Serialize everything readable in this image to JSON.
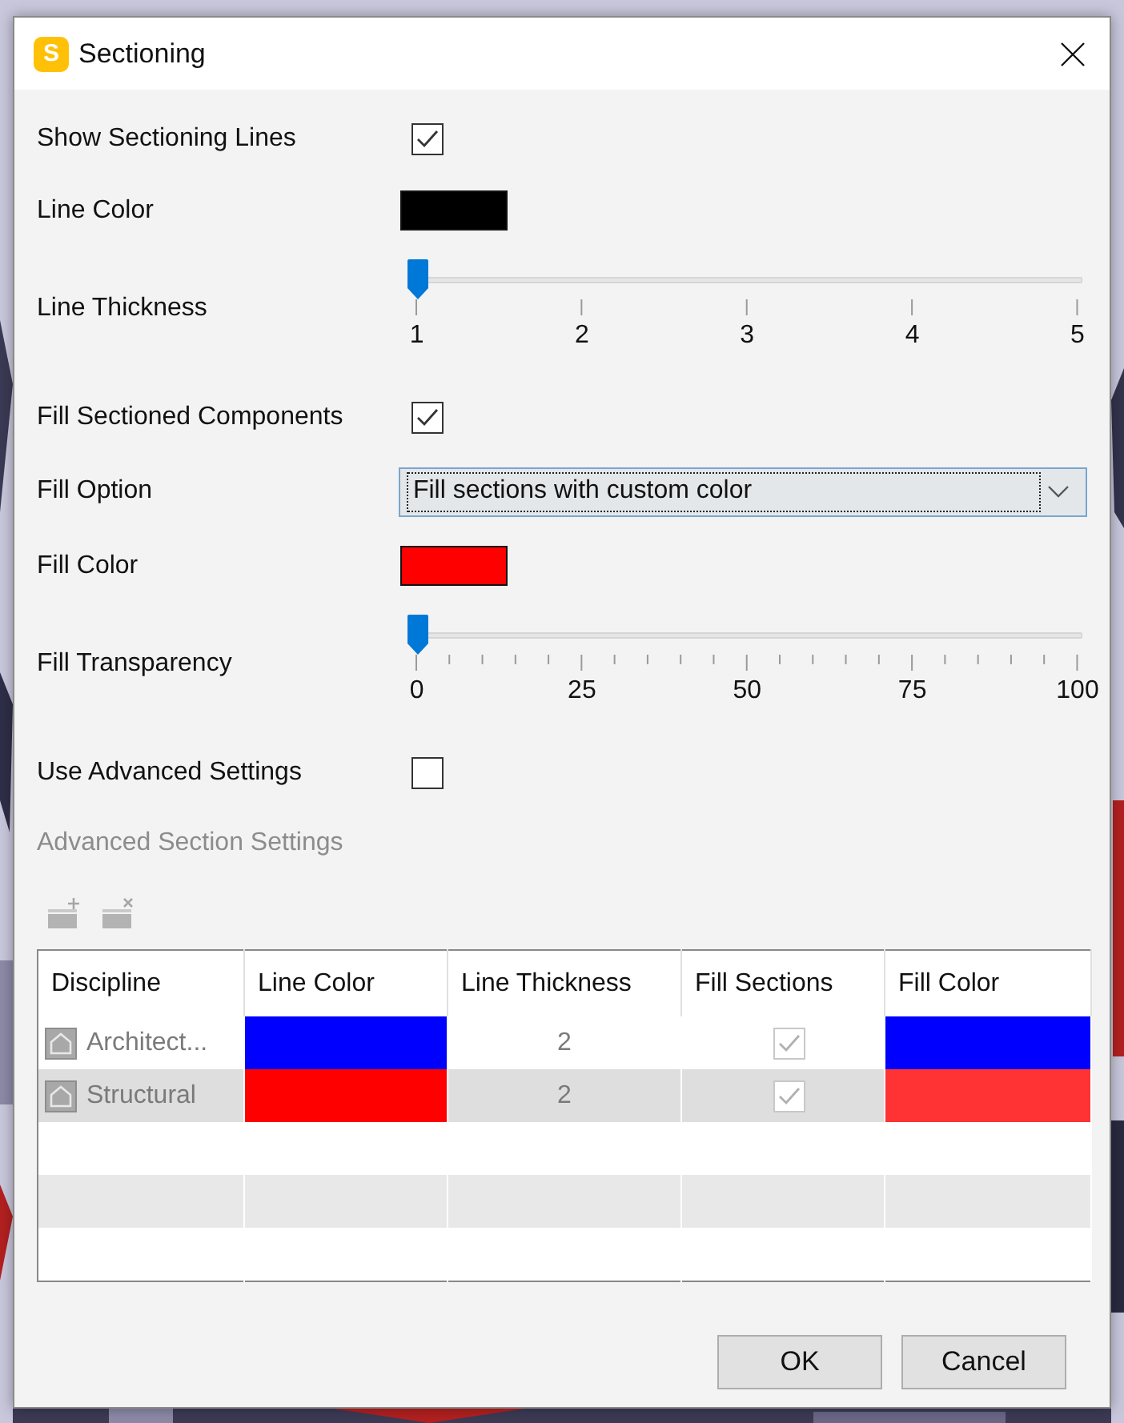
{
  "window": {
    "title": "Sectioning",
    "app_icon_letter": "S"
  },
  "settings": [
    {
      "kind": "checkbox",
      "label": "Show Sectioning Lines",
      "checked": true
    },
    {
      "kind": "color",
      "label": "Line Color",
      "color": "#000000"
    },
    {
      "kind": "slider",
      "label": "Line Thickness",
      "level": 0,
      "tick_labels": [
        "1",
        "2",
        "3",
        "4",
        "5"
      ],
      "minor_ticks": false
    },
    {
      "kind": "checkbox",
      "label": "Fill Sectioned Components",
      "checked": true
    },
    {
      "kind": "dropdown",
      "label": "Fill Option",
      "value": "Fill sections with custom color"
    },
    {
      "kind": "color",
      "label": "Fill Color",
      "color": "#ff0000"
    },
    {
      "kind": "slider",
      "label": "Fill Transparency",
      "level": 0,
      "tick_labels": [
        "0",
        "25",
        "50",
        "75",
        "100"
      ],
      "minor_ticks": true
    },
    {
      "kind": "checkbox",
      "label": "Use Advanced Settings",
      "checked": false
    }
  ],
  "advanced": {
    "title": "Advanced Section Settings",
    "disabled": true,
    "table": {
      "columns": [
        "Discipline",
        "Line Color",
        "Line Thickness",
        "Fill Sections",
        "Fill Color"
      ],
      "rows": [
        {
          "discipline": "Architect...",
          "line_color": {
            "color": "#0000ff"
          },
          "line_thickness": "2",
          "fill_sections": true,
          "fill_color": {
            "color": "#0000ff"
          }
        },
        {
          "discipline": "Structural",
          "line_color": {
            "color": "#ff0000"
          },
          "line_thickness": "2",
          "fill_sections": true,
          "fill_color": {
            "color": "#ff3333"
          }
        }
      ]
    }
  },
  "buttons": [
    "OK",
    "Cancel"
  ]
}
